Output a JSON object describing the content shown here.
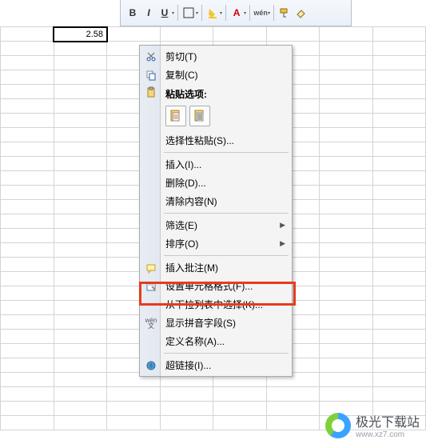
{
  "cell": {
    "value": "2.58"
  },
  "toolbar": {
    "bold": "B",
    "italic": "I",
    "underline": "U"
  },
  "menu": {
    "cut": {
      "label": "剪切(T)",
      "hotkey": "T"
    },
    "copy": {
      "label": "复制(C)",
      "hotkey": "C"
    },
    "paste_options": {
      "label": "粘贴选项:"
    },
    "paste_special": {
      "label": "选择性粘贴(S)...",
      "hotkey": "S"
    },
    "insert": {
      "label": "插入(I)...",
      "hotkey": "I"
    },
    "delete": {
      "label": "删除(D)...",
      "hotkey": "D"
    },
    "clear": {
      "label": "清除内容(N)",
      "hotkey": "N"
    },
    "filter": {
      "label": "筛选(E)",
      "hotkey": "E",
      "has_submenu": true
    },
    "sort": {
      "label": "排序(O)",
      "hotkey": "O",
      "has_submenu": true
    },
    "insert_comment": {
      "label": "插入批注(M)",
      "hotkey": "M"
    },
    "format_cells": {
      "label": "设置单元格格式(F)...",
      "hotkey": "F"
    },
    "pick_from_list": {
      "label": "从下拉列表中选择(K)...",
      "hotkey": "K"
    },
    "show_pinyin": {
      "label": "显示拼音字段(S)",
      "hotkey": "S"
    },
    "define_name": {
      "label": "定义名称(A)...",
      "hotkey": "A"
    },
    "hyperlink": {
      "label": "超链接(I)...",
      "hotkey": "I"
    }
  },
  "watermark": {
    "title": "极光下载站",
    "url": "www.xz7.com"
  }
}
